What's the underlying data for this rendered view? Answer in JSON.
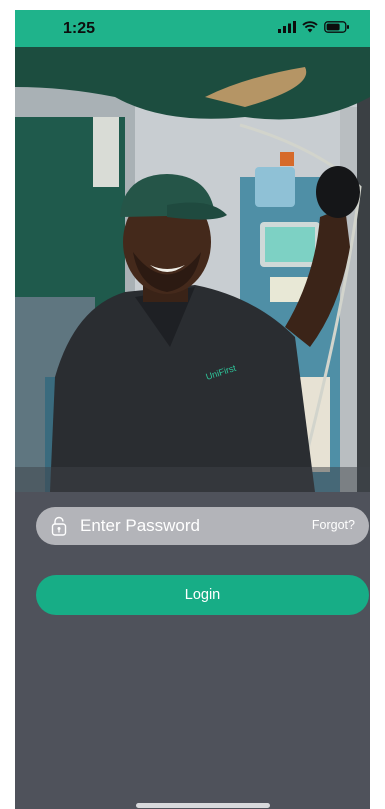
{
  "status_bar": {
    "time": "1:25",
    "icons": [
      "signal-icon",
      "wifi-icon",
      "battery-icon"
    ]
  },
  "hero": {
    "description_icon": "worker-photo",
    "shirt_logo": "UniFirst"
  },
  "login_form": {
    "password": {
      "value": "",
      "placeholder": "Enter Password"
    },
    "forgot_label": "Forgot?",
    "login_label": "Login"
  },
  "colors": {
    "brand_green": "#1fb38b",
    "button_green": "#17ad86",
    "panel_gray": "#4f525b",
    "field_gray": "#b3b4b9"
  }
}
